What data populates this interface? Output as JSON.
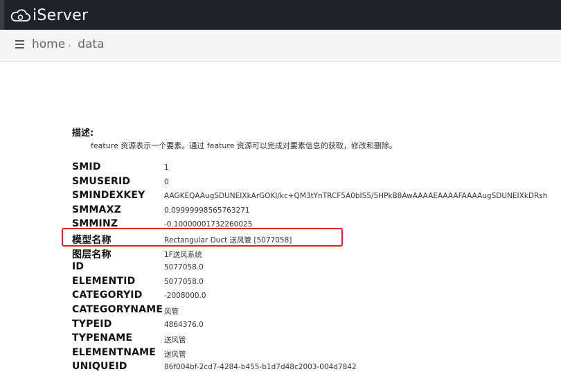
{
  "header": {
    "brand_prefix": "i",
    "brand_name": "Server"
  },
  "breadcrumb": {
    "home": "home",
    "separator": "›",
    "current": "data"
  },
  "description": {
    "title": "描述:",
    "text": "feature 资源表示一个要素。通过 feature 资源可以完成对要素信息的获取，修改和删除。"
  },
  "fields": [
    {
      "key": "SMID",
      "value": "1"
    },
    {
      "key": "SMUSERID",
      "value": "0"
    },
    {
      "key": "SMINDEXKEY",
      "value": "AAGKEQAAugSDUNEIXkArGOKl/kc+QM3tYnTRCF5A0bIS5/5HPkB8AwAAAAEAAAAFAAAAugSDUNEIXkDRsh"
    },
    {
      "key": "SMMAXZ",
      "value": "0.09999998565763271"
    },
    {
      "key": "SMMINZ",
      "value": "-0.10000001732260025"
    },
    {
      "key": "模型名称",
      "value": "Rectangular Duct 送风管 [5077058]"
    },
    {
      "key": "图层名称",
      "value": "1F送风系统"
    },
    {
      "key": "ID",
      "value": "5077058.0"
    },
    {
      "key": "ELEMENTID",
      "value": "5077058.0"
    },
    {
      "key": "CATEGORYID",
      "value": "-2008000.0"
    },
    {
      "key": "CATEGORYNAME",
      "value": "风管"
    },
    {
      "key": "TYPEID",
      "value": "4864376.0"
    },
    {
      "key": "TYPENAME",
      "value": "送风管"
    },
    {
      "key": "ELEMENTNAME",
      "value": "送风管"
    },
    {
      "key": "UNIQUEID",
      "value": "86f004bf-2cd7-4284-b455-b1d7d48c2003-004d7842"
    }
  ],
  "colors": {
    "header_bg": "#1f2228",
    "highlight_border": "#e02424",
    "crumb_bg": "#f5f5f5"
  },
  "icons": {
    "logo": "cloud-icon",
    "breadcrumb": "list-icon"
  }
}
